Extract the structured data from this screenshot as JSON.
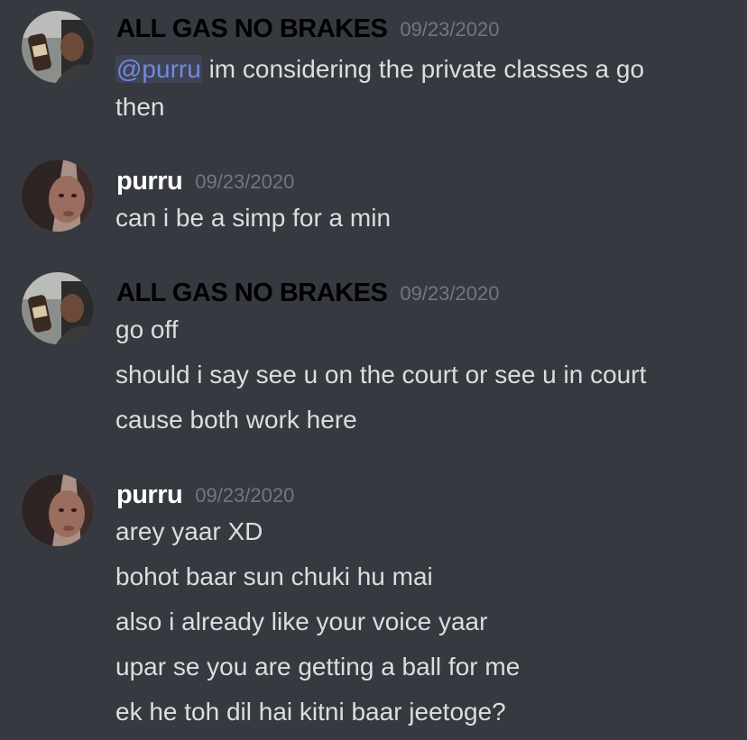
{
  "colors": {
    "background": "#36393f",
    "username_gas": "#000000",
    "username_purru": "#ffffff",
    "timestamp": "#72767d",
    "message_text": "#dcddde",
    "mention": "#7289da"
  },
  "messages": [
    {
      "author": "ALL GAS NO BRAKES",
      "timestamp": "09/23/2020",
      "avatar": "avatar-gas",
      "lines": [
        {
          "mention": "@purru",
          "text": " im considering the private classes a go"
        },
        {
          "text": "then"
        }
      ]
    },
    {
      "author": "purru",
      "timestamp": "09/23/2020",
      "avatar": "avatar-purru",
      "lines": [
        {
          "text": "can i be a simp for a min"
        }
      ]
    },
    {
      "author": "ALL GAS NO BRAKES",
      "timestamp": "09/23/2020",
      "avatar": "avatar-gas",
      "lines": [
        {
          "text": "go off"
        },
        {
          "text": "should i say see u on the court or see u in court"
        },
        {
          "text": "cause both work here"
        }
      ]
    },
    {
      "author": "purru",
      "timestamp": "09/23/2020",
      "avatar": "avatar-purru",
      "lines": [
        {
          "text": "arey yaar XD"
        },
        {
          "text": "bohot baar sun chuki hu mai"
        },
        {
          "text": "also i already like your voice yaar"
        },
        {
          "text": "upar se you are getting a ball for me"
        },
        {
          "text": "ek he toh dil hai kitni baar jeetoge?"
        }
      ]
    }
  ]
}
